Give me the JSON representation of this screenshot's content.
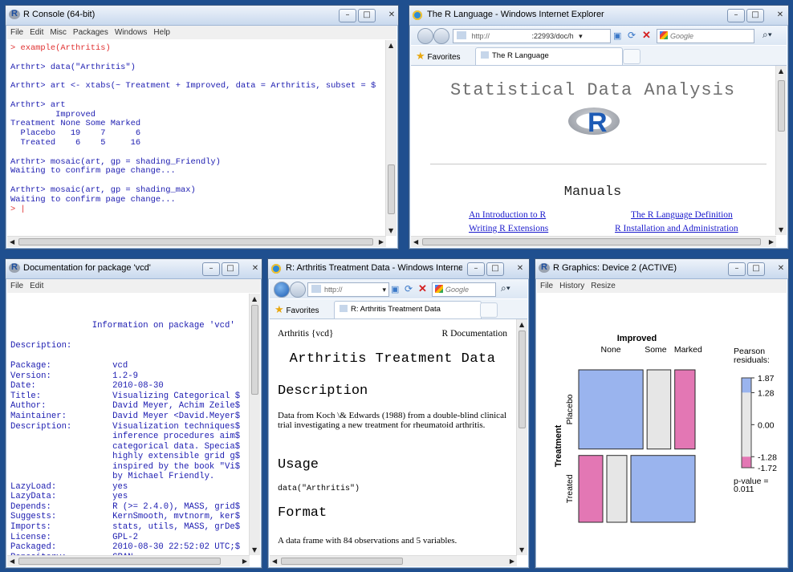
{
  "console": {
    "title": "R Console (64-bit)",
    "menu": [
      "File",
      "Edit",
      "Misc",
      "Packages",
      "Windows",
      "Help"
    ],
    "lines": [
      {
        "t": "> example(Arthritis)",
        "red": true
      },
      {
        "t": ""
      },
      {
        "t": "Arthrt> data(\"Arthritis\")"
      },
      {
        "t": ""
      },
      {
        "t": "Arthrt> art <- xtabs(~ Treatment + Improved, data = Arthritis, subset = $"
      },
      {
        "t": ""
      },
      {
        "t": "Arthrt> art"
      },
      {
        "t": "         Improved"
      },
      {
        "t": "Treatment None Some Marked"
      },
      {
        "t": "  Placebo   19    7      6"
      },
      {
        "t": "  Treated    6    5     16"
      },
      {
        "t": ""
      },
      {
        "t": "Arthrt> mosaic(art, gp = shading_Friendly)"
      },
      {
        "t": "Waiting to confirm page change..."
      },
      {
        "t": ""
      },
      {
        "t": "Arthrt> mosaic(art, gp = shading_max)"
      },
      {
        "t": "Waiting to confirm page change..."
      },
      {
        "t": "> |",
        "red": true
      }
    ]
  },
  "ie_main": {
    "title": "The R Language - Windows Internet Explorer",
    "address_left": "http://",
    "address_right": ":22993/doc/h",
    "search_placeholder": "Google",
    "favorites": "Favorites",
    "tab": "The R Language",
    "heading": "Statistical Data Analysis",
    "logo_letter": "R",
    "manuals": "Manuals",
    "links": [
      "An Introduction to R",
      "The R Language Definition",
      "Writing R Extensions",
      "R Installation and Administration"
    ]
  },
  "vcd_doc": {
    "title": "Documentation for package 'vcd'",
    "menu": [
      "File",
      "Edit"
    ],
    "lines": [
      "",
      "",
      "                Information on package 'vcd'",
      "",
      "Description:",
      "",
      "Package:            vcd",
      "Version:            1.2-9",
      "Date:               2010-08-30",
      "Title:              Visualizing Categorical $",
      "Author:             David Meyer, Achim Zeile$",
      "Maintainer:         David Meyer <David.Meyer$",
      "Description:        Visualization techniques$",
      "                    inference procedures aim$",
      "                    categorical data. Specia$",
      "                    highly extensible grid g$",
      "                    inspired by the book \"Vi$",
      "                    by Michael Friendly.",
      "LazyLoad:           yes",
      "LazyData:           yes",
      "Depends:            R (>= 2.4.0), MASS, grid$",
      "Suggests:           KernSmooth, mvtnorm, ker$",
      "Imports:            stats, utils, MASS, grDe$",
      "License:            GPL-2",
      "Packaged:           2010-08-30 22:52:02 UTC;$",
      "Repository:         CRAN"
    ]
  },
  "ie_arthritis": {
    "title": "R: Arthritis Treatment Data - Windows Internet Explo...",
    "address": "http://",
    "search_placeholder": "Google",
    "favorites": "Favorites",
    "tab": "R: Arthritis Treatment Data",
    "header_left": "Arthritis {vcd}",
    "header_right": "R Documentation",
    "h1": "Arthritis Treatment Data",
    "h_description": "Description",
    "description": "Data from Koch \\& Edwards (1988) from a double-blind clinical trial investigating a new treatment for rheumatoid arthritis.",
    "h_usage": "Usage",
    "usage": "data(\"Arthritis\")",
    "h_format": "Format",
    "format": "A data frame with 84 observations and 5 variables."
  },
  "graphics": {
    "title": "R Graphics: Device 2 (ACTIVE)",
    "menu": [
      "File",
      "History",
      "Resize"
    ],
    "chart_data": {
      "type": "mosaic",
      "top_label": "Improved",
      "column_labels": [
        "None",
        "Some",
        "Marked"
      ],
      "side_label": "Treatment",
      "row_labels": [
        "Placebo",
        "Treated"
      ],
      "counts": {
        "Placebo": [
          19,
          7,
          6
        ],
        "Treated": [
          6,
          5,
          16
        ]
      },
      "legend_title": "Pearson\nresiduals:",
      "legend_ticks": [
        "1.87",
        "1.28",
        "0.00",
        "-1.28",
        "-1.72"
      ],
      "p_value": "p-value =\n0.011",
      "colors": {
        "positive": "#9ab4ee",
        "negative": "#e377b4",
        "neutral": "#e6e6e6",
        "border": "#2a2a2a"
      }
    }
  }
}
